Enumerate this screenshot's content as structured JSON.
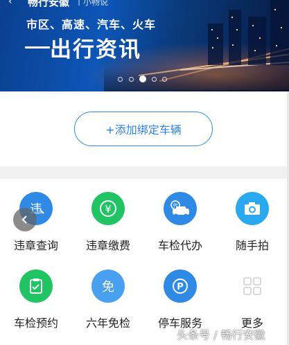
{
  "header": {
    "back_icon": "back-arrow-icon",
    "app_title": "畅行安徽",
    "separator": "|",
    "subtitle": "小畅说"
  },
  "banner": {
    "tagline": "市区、高速、汽车、火车",
    "headline": "出行资讯",
    "carousel_count": 5,
    "carousel_active_index": 2
  },
  "add_vehicle": {
    "label": "+添加绑定车辆",
    "accent_color": "#2f8be6"
  },
  "services": [
    {
      "label": "违章查询",
      "icon": "traffic-violation-icon",
      "color": "#2f8ae6"
    },
    {
      "label": "违章缴费",
      "icon": "yuan-payment-icon",
      "color": "#20c463"
    },
    {
      "label": "车检代办",
      "icon": "car-inspection-agent-icon",
      "color": "#2f8ae6"
    },
    {
      "label": "随手拍",
      "icon": "camera-icon",
      "color": "#2aa8ef"
    },
    {
      "label": "车检预约",
      "icon": "inspection-booking-icon",
      "color": "#20c463"
    },
    {
      "label": "六年免检",
      "icon": "exempt-inspection-icon",
      "color": "#4aa0f0"
    },
    {
      "label": "停车服务",
      "icon": "parking-icon",
      "color": "#2f8ae6"
    },
    {
      "label": "更多",
      "icon": "more-grid-icon",
      "color": "#cfcfcf"
    }
  ],
  "watermark": "头条号 / 畅行安徽"
}
